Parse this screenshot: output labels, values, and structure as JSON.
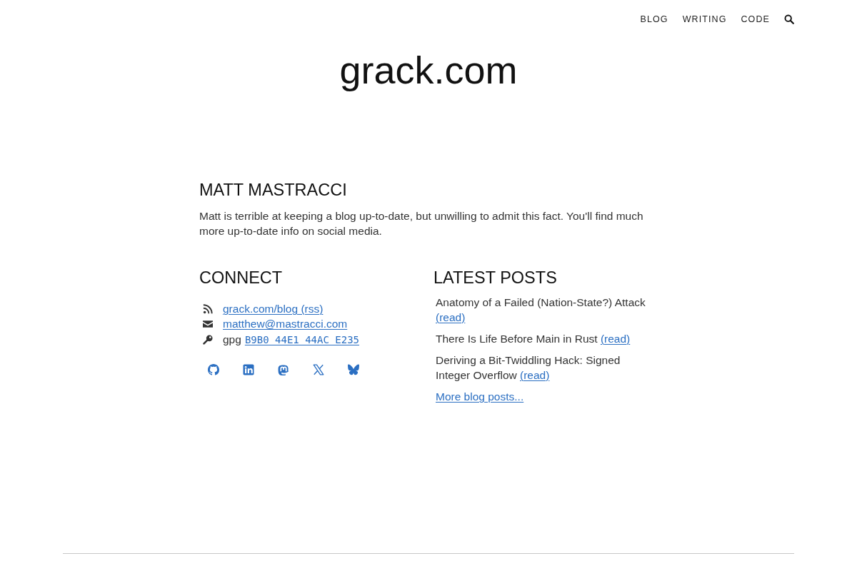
{
  "nav": [
    "BLOG",
    "WRITING",
    "CODE"
  ],
  "site_title": "grack.com",
  "about": {
    "heading": "MATT MASTRACCI",
    "text": "Matt is terrible at keeping a blog up-to-date, but unwilling to admit this fact. You'll find much more up-to-date info on social media."
  },
  "connect": {
    "heading": "CONNECT",
    "items": [
      {
        "kind": "rss",
        "link": "grack.com/blog (rss)"
      },
      {
        "kind": "email",
        "link": "matthew@mastracci.com"
      },
      {
        "kind": "gpg",
        "label": "gpg",
        "link": "B9B0 44E1 44AC E235"
      }
    ]
  },
  "latest_posts": {
    "heading": "LATEST POSTS",
    "posts": [
      {
        "title": "Anatomy of a Failed (Nation-State?) Attack",
        "link": "(read)"
      },
      {
        "title": "There Is Life Before Main in Rust",
        "link": "(read)"
      },
      {
        "title": "Deriving a Bit-Twiddling Hack: Signed Integer Overflow",
        "link": "(read)"
      }
    ],
    "more_link": "More blog posts..."
  }
}
